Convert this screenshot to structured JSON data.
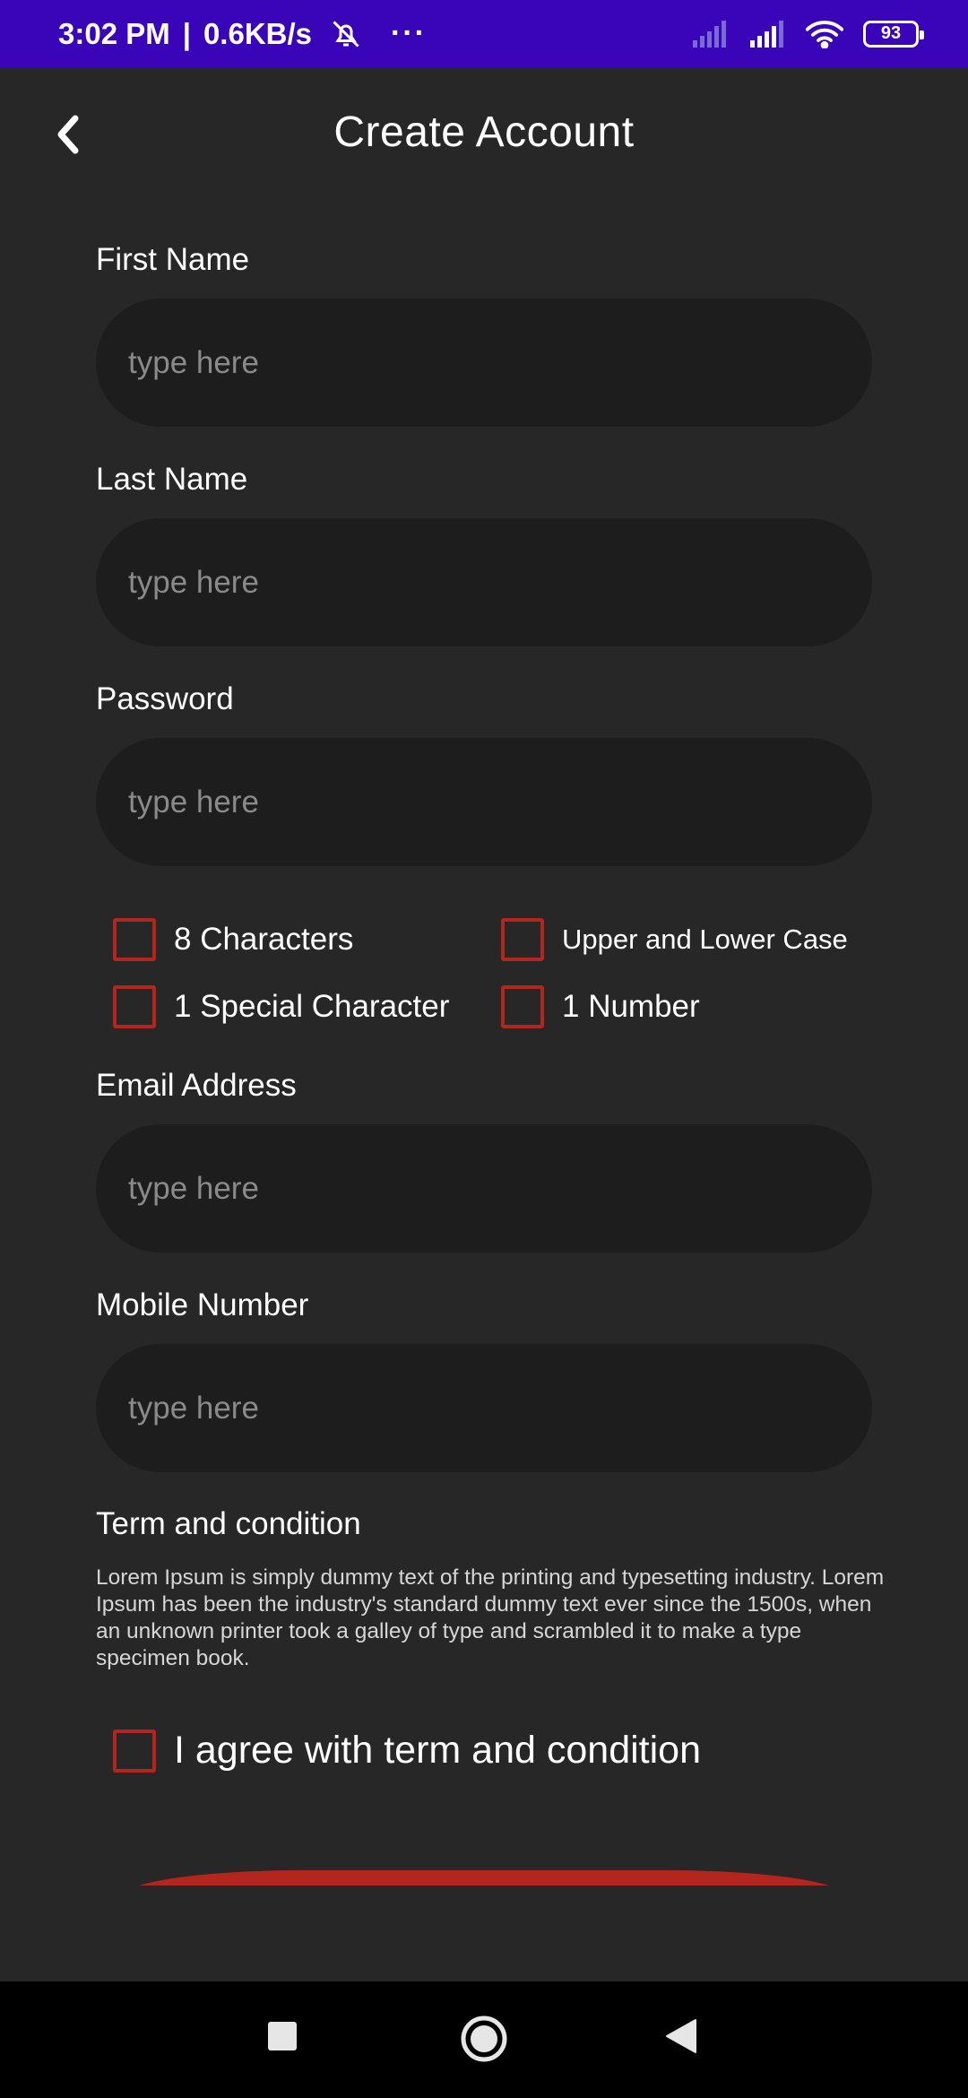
{
  "status_bar": {
    "time": "3:02 PM",
    "speed": "0.6KB/s",
    "separator": "|",
    "more": "···",
    "battery": "93",
    "icons": [
      "bell-off-icon",
      "signal-icon",
      "signal-icon",
      "wifi-icon",
      "battery-icon"
    ]
  },
  "header": {
    "title": "Create Account",
    "back_icon": "chevron-left-icon"
  },
  "form": {
    "first_name": {
      "label": "First Name",
      "placeholder": "type here",
      "value": ""
    },
    "last_name": {
      "label": "Last Name",
      "placeholder": "type here",
      "value": ""
    },
    "password": {
      "label": "Password",
      "placeholder": "type here",
      "value": ""
    },
    "password_rules": [
      {
        "label": "8 Characters",
        "checked": false
      },
      {
        "label": "Upper and Lower Case",
        "checked": false
      },
      {
        "label": "1 Special Character",
        "checked": false
      },
      {
        "label": "1 Number",
        "checked": false
      }
    ],
    "email": {
      "label": "Email Address",
      "placeholder": "type here",
      "value": ""
    },
    "mobile": {
      "label": "Mobile Number",
      "placeholder": "type here",
      "value": ""
    }
  },
  "terms": {
    "title": "Term and condition",
    "body": "Lorem Ipsum is simply dummy text of the printing and typesetting industry. Lorem Ipsum has been the industry's standard dummy text ever since the 1500s, when an unknown printer took a galley of type and scrambled it to make a type specimen book.",
    "agree_label": "I agree with term and condition",
    "agree_checked": false
  },
  "colors": {
    "status_bar": "#3a05b8",
    "background": "#272727",
    "input": "#1d1d1d",
    "accent": "#b3261e"
  },
  "nav": {
    "icons": [
      "recents-square-icon",
      "home-circle-icon",
      "back-triangle-icon"
    ]
  }
}
